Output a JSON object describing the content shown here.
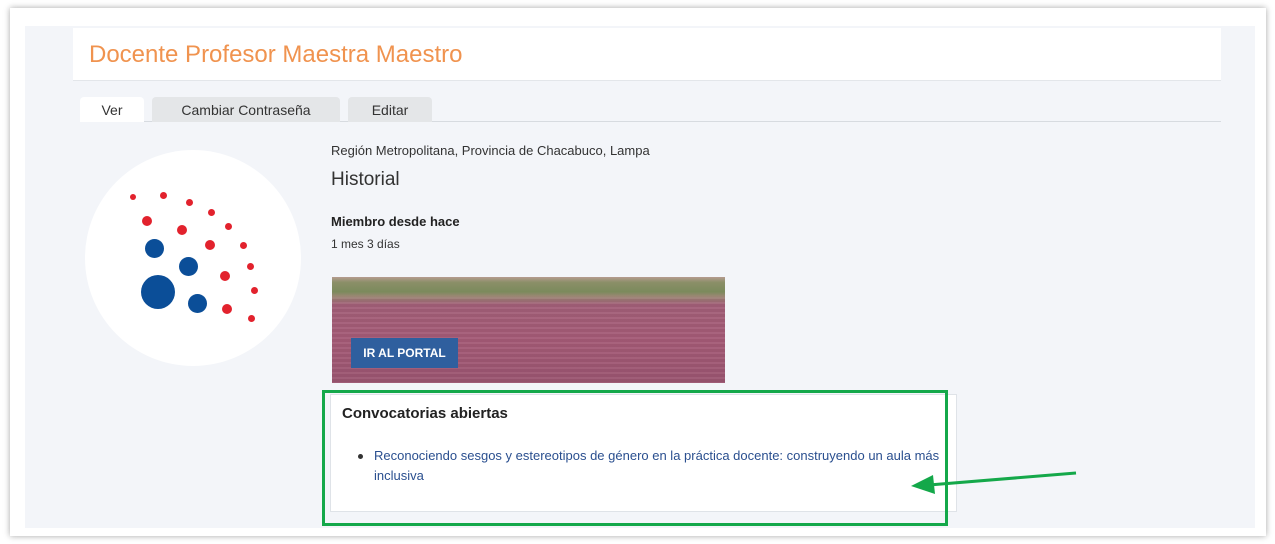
{
  "header": {
    "title": "Docente Profesor Maestra Maestro"
  },
  "tabs": [
    {
      "label": "Ver",
      "active": true
    },
    {
      "label": "Cambiar Contraseña",
      "active": false
    },
    {
      "label": "Editar",
      "active": false
    }
  ],
  "profile": {
    "location": "Región Metropolitana, Provincia de Chacabuco, Lampa",
    "history_heading": "Historial",
    "member_since_label": "Miembro desde hace",
    "member_since_value": "1 mes 3 días",
    "avatar_icon": "dot-pattern-logo"
  },
  "banner": {
    "button_label": "IR AL PORTAL"
  },
  "calls": {
    "title": "Convocatorias abiertas",
    "items": [
      {
        "label": "Reconociendo sesgos y estereotipos de género en la práctica docente: construyendo un aula más inclusiva"
      }
    ]
  },
  "annotation": {
    "highlight_color": "#14a84a",
    "arrow_icon": "arrow-left-icon"
  },
  "colors": {
    "title": "#f0934f",
    "link": "#2a4f8f",
    "button": "#2f5f9e",
    "logo_red": "#e2222d",
    "logo_blue": "#0b4e98"
  }
}
